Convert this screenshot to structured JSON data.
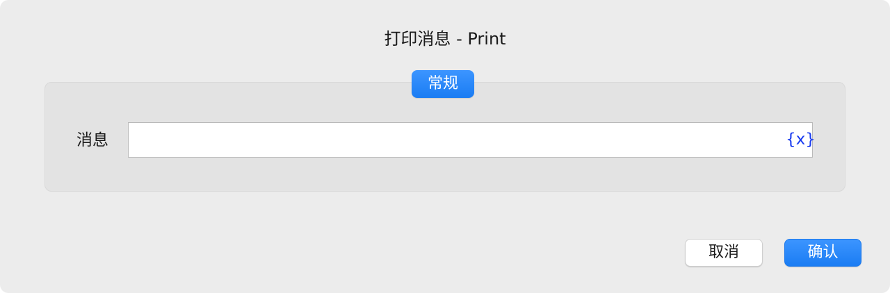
{
  "dialog": {
    "title": "打印消息 - Print"
  },
  "group": {
    "tab_label": "常规"
  },
  "message_field": {
    "label": "消息",
    "value": "",
    "variable_button_label": "{x}"
  },
  "buttons": {
    "cancel_label": "取消",
    "ok_label": "确认"
  },
  "colors": {
    "accent": "#1a7cf3",
    "variable_icon": "#1a3cf0",
    "dialog_background": "#ececec",
    "group_background": "#e3e3e3"
  }
}
